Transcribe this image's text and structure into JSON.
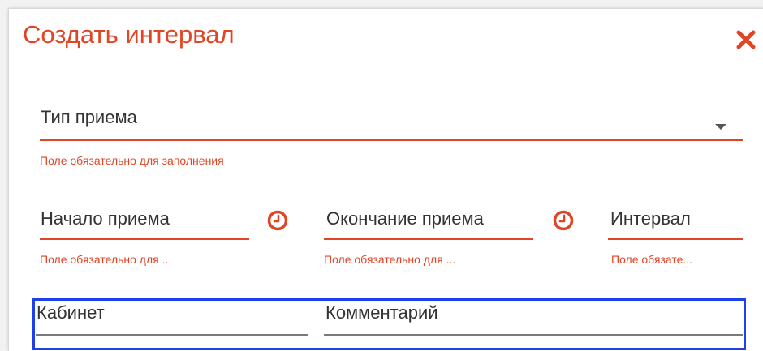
{
  "dialog": {
    "title": "Создать интервал",
    "close_icon": "close-icon",
    "accent_color": "#e04526",
    "focus_color": "#1f3fe8"
  },
  "fields": {
    "type": {
      "label": "Тип приема",
      "error": "Поле обязательно для заполнения",
      "icon": "dropdown-arrow-icon"
    },
    "start": {
      "label": "Начало приема",
      "error": "Поле обязательно для ...",
      "icon": "clock-icon"
    },
    "end": {
      "label": "Окончание приема",
      "error": "Поле обязательно для ...",
      "icon": "clock-icon"
    },
    "interval": {
      "label": "Интервал",
      "error": "Поле обязате..."
    },
    "cabinet": {
      "label": "Кабинет"
    },
    "comment": {
      "label": "Комментарий"
    }
  }
}
